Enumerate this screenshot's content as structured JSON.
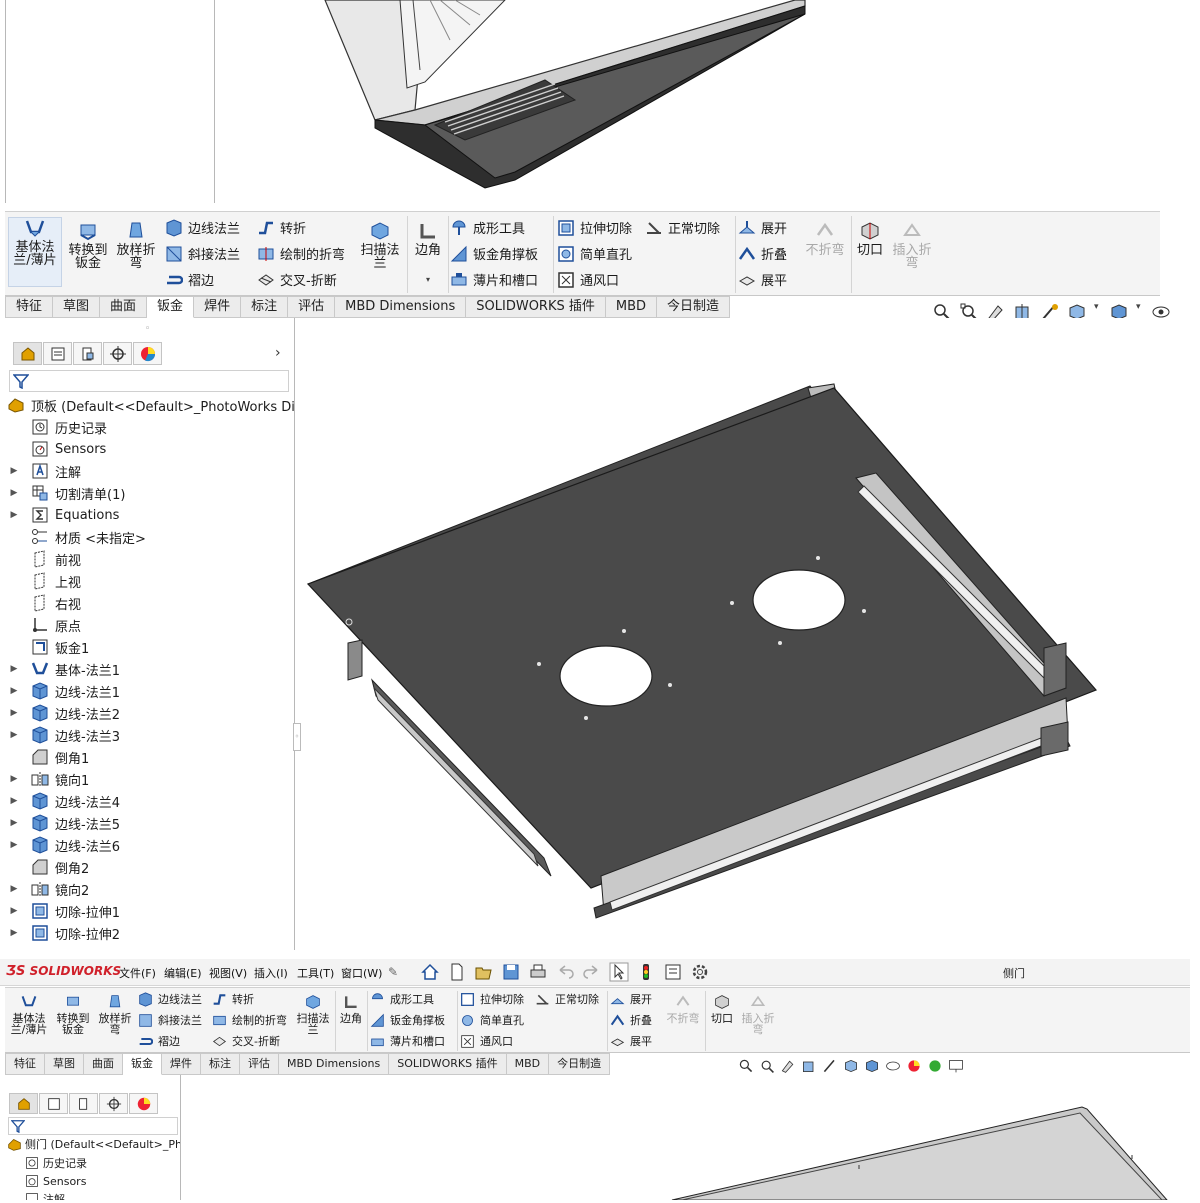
{
  "ribbon": {
    "base_flange": "基体法\n兰/薄片",
    "convert_to_sheet": "转换到\n钣金",
    "lofted_bend": "放样折\n弯",
    "edge_flange": "边线法兰",
    "miter_flange": "斜接法兰",
    "hem": "褶边",
    "jog": "转折",
    "sketched_bend": "绘制的折弯",
    "cross_break": "交叉-折断",
    "swept_flange": "扫描法\n兰",
    "corner": "边角",
    "forming_tool": "成形工具",
    "sheet_gusset": "钣金角撑板",
    "tab_and_slot": "薄片和槽口",
    "extruded_cut": "拉伸切除",
    "simple_hole": "简单直孔",
    "vent": "通风口",
    "normal_cut": "正常切除",
    "unfold": "展开",
    "fold": "折叠",
    "flatten": "展平",
    "no_bends": "不折弯",
    "rip": "切口",
    "insert_bends": "插入折\n弯"
  },
  "tabs": [
    "特征",
    "草图",
    "曲面",
    "钣金",
    "焊件",
    "标注",
    "评估",
    "MBD Dimensions",
    "SOLIDWORKS 插件",
    "MBD",
    "今日制造"
  ],
  "active_tab": "钣金",
  "tree": {
    "root": "顶板  (Default<<Default>_PhotoWorks Displa",
    "items": [
      {
        "label": "历史记录",
        "icon": "history-icon",
        "expandable": false
      },
      {
        "label": "Sensors",
        "icon": "sensors-icon",
        "expandable": false
      },
      {
        "label": "注解",
        "icon": "annotations-icon",
        "expandable": true
      },
      {
        "label": "切割清单(1)",
        "icon": "cut-list-icon",
        "expandable": true
      },
      {
        "label": "Equations",
        "icon": "equations-icon",
        "expandable": true
      },
      {
        "label": "材质 <未指定>",
        "icon": "material-icon",
        "expandable": false
      },
      {
        "label": "前视",
        "icon": "plane-icon",
        "expandable": false
      },
      {
        "label": "上视",
        "icon": "plane-icon",
        "expandable": false
      },
      {
        "label": "右视",
        "icon": "plane-icon",
        "expandable": false
      },
      {
        "label": "原点",
        "icon": "origin-icon",
        "expandable": false
      },
      {
        "label": "钣金1",
        "icon": "sheet-metal-icon",
        "expandable": false
      },
      {
        "label": "基体-法兰1",
        "icon": "base-flange-icon",
        "expandable": true
      },
      {
        "label": "边线-法兰1",
        "icon": "edge-flange-icon",
        "expandable": true
      },
      {
        "label": "边线-法兰2",
        "icon": "edge-flange-icon",
        "expandable": true
      },
      {
        "label": "边线-法兰3",
        "icon": "edge-flange-icon",
        "expandable": true
      },
      {
        "label": "倒角1",
        "icon": "chamfer-icon",
        "expandable": false
      },
      {
        "label": "镜向1",
        "icon": "mirror-icon",
        "expandable": true
      },
      {
        "label": "边线-法兰4",
        "icon": "edge-flange-icon",
        "expandable": true
      },
      {
        "label": "边线-法兰5",
        "icon": "edge-flange-icon",
        "expandable": true
      },
      {
        "label": "边线-法兰6",
        "icon": "edge-flange-icon",
        "expandable": true
      },
      {
        "label": "倒角2",
        "icon": "chamfer-icon",
        "expandable": false
      },
      {
        "label": "镜向2",
        "icon": "mirror-icon",
        "expandable": true
      },
      {
        "label": "切除-拉伸1",
        "icon": "cut-extrude-icon",
        "expandable": true
      },
      {
        "label": "切除-拉伸2",
        "icon": "cut-extrude-icon",
        "expandable": true
      }
    ]
  },
  "menubar": {
    "logo": "SOLIDWORKS",
    "items": [
      "文件(F)",
      "编辑(E)",
      "视图(V)",
      "插入(I)",
      "工具(T)",
      "窗口(W)"
    ],
    "doc_title": "侧门"
  },
  "tree2": {
    "root": "侧门  (Default<<Default>_Photo",
    "items": [
      "历史记录",
      "Sensors",
      "注解"
    ]
  },
  "colors": {
    "sheet_dark": "#4a4a4a",
    "sheet_light": "#c8c8c8",
    "accent": "#e0a000",
    "ribbon_bg": "#f4f4f4"
  }
}
